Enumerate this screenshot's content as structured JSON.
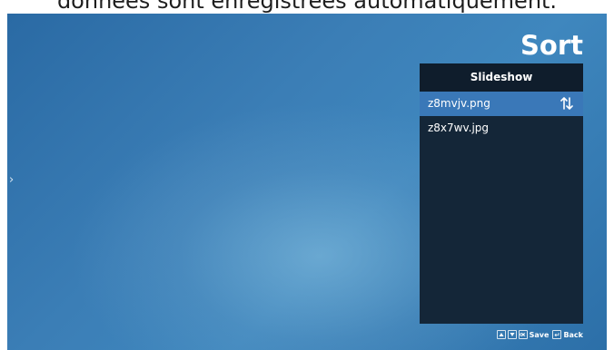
{
  "caption": {
    "text": "données sont enregistrées automatiquement."
  },
  "screen": {
    "title": "Sort",
    "panel": {
      "header": "Slideshow",
      "files": [
        {
          "name": "z8mvjv.png",
          "selected": true
        },
        {
          "name": "z8x7wv.jpg",
          "selected": false
        }
      ]
    },
    "hints": {
      "save_label": "Save",
      "back_label": "Back",
      "icons": [
        "up-key-icon",
        "down-key-icon",
        "ok-key-icon",
        "back-key-icon"
      ]
    }
  },
  "colors": {
    "background_top": "#2a6aa4",
    "background_glow": "#8cc3e1",
    "panel": "#142638",
    "panel_header": "#0f1d2c",
    "selection": "#3a78b8",
    "text": "#ffffff"
  }
}
